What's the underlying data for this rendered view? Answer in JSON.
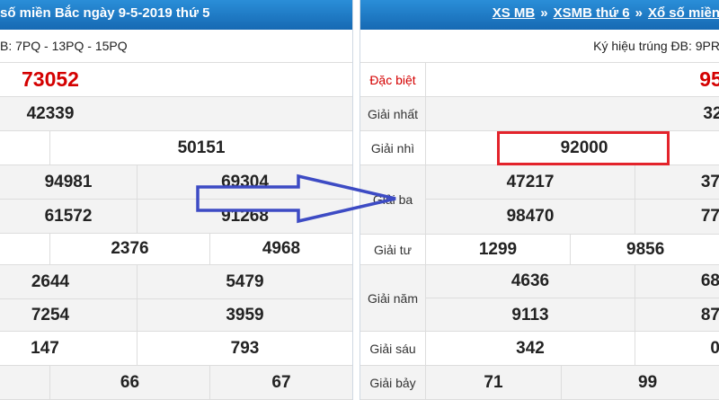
{
  "left": {
    "header": "số miền Bắc ngày 9-5-2019 thứ 5",
    "symbols": "B: 7PQ - 13PQ - 15PQ",
    "special": "73052",
    "first": "42339",
    "second": "50151",
    "third": [
      "94981",
      "69304",
      "61572",
      "91268"
    ],
    "fourth": [
      "2376",
      "4968"
    ],
    "fifth": [
      "2644",
      "5479",
      "7254",
      "3959"
    ],
    "sixth": [
      "147",
      "793"
    ],
    "seventh": [
      "66",
      "67"
    ]
  },
  "right": {
    "nav": [
      "XS MB",
      "XSMB thứ 6",
      "Xổ số miền"
    ],
    "nav_sep": "»",
    "symbols": "Ký hiệu trúng ĐB: 9PR",
    "labels": {
      "special": "Đặc biệt",
      "first": "Giải nhất",
      "second": "Giải nhì",
      "third": "Giải ba",
      "fourth": "Giải tư",
      "fifth": "Giải năm",
      "sixth": "Giải sáu",
      "seventh": "Giải bảy"
    },
    "special": "95",
    "first": "32",
    "second": "92000",
    "third": [
      "47217",
      "37",
      "98470",
      "77"
    ],
    "fourth": [
      "1299",
      "9856"
    ],
    "fifth": [
      "4636",
      "68",
      "9113",
      "87"
    ],
    "sixth": [
      "342",
      "0"
    ],
    "seventh": [
      "71",
      "99"
    ]
  },
  "colors": {
    "header_blue": "#1a78c2",
    "special_red": "#d40000",
    "highlight_red": "#e3232b",
    "arrow_blue": "#3d4bc4"
  }
}
